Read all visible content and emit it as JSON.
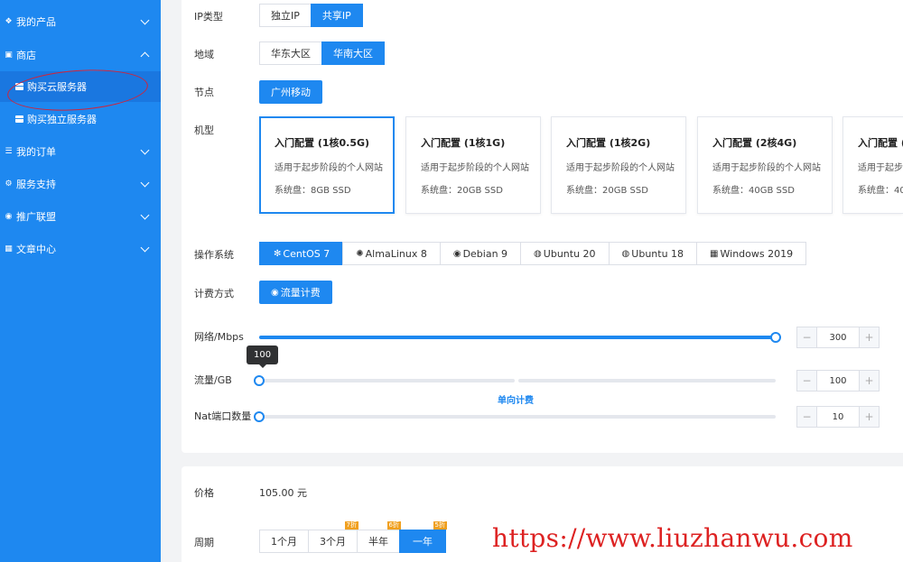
{
  "sidebar": {
    "items": [
      {
        "label": "我的产品",
        "icon": "product-icon"
      },
      {
        "label": "商店",
        "icon": "store-icon"
      },
      {
        "label": "我的订单",
        "icon": "orders-icon"
      },
      {
        "label": "服务支持",
        "icon": "support-icon"
      },
      {
        "label": "推广联盟",
        "icon": "affiliate-icon"
      },
      {
        "label": "文章中心",
        "icon": "article-icon"
      }
    ],
    "subitems": [
      {
        "label": "购买云服务器"
      },
      {
        "label": "购买独立服务器"
      }
    ],
    "accent": "#1e88f0",
    "annotation_color": "#d0243a"
  },
  "form": {
    "ip_type": {
      "label": "IP类型",
      "options": [
        "独立IP",
        "共享IP"
      ],
      "selected": "共享IP"
    },
    "region": {
      "label": "地域",
      "options": [
        "华东大区",
        "华南大区"
      ],
      "selected": "华南大区"
    },
    "node": {
      "label": "节点",
      "value": "广州移动"
    },
    "model": {
      "label": "机型",
      "cards": [
        {
          "title": "入门配置 (1核0.5G)",
          "desc": "适用于起步阶段的个人网站",
          "disk": "系统盘：8GB SSD"
        },
        {
          "title": "入门配置 (1核1G)",
          "desc": "适用于起步阶段的个人网站",
          "disk": "系统盘：20GB SSD"
        },
        {
          "title": "入门配置 (1核2G)",
          "desc": "适用于起步阶段的个人网站",
          "disk": "系统盘：20GB SSD"
        },
        {
          "title": "入门配置 (2核4G)",
          "desc": "适用于起步阶段的个人网站",
          "disk": "系统盘：40GB SSD"
        },
        {
          "title": "入门配置 (",
          "desc": "适用于起步",
          "disk": "系统盘：40"
        }
      ]
    },
    "os": {
      "label": "操作系统",
      "options": [
        {
          "name": "CentOS 7",
          "icon": "centos-icon",
          "glyph": "✻"
        },
        {
          "name": "AlmaLinux 8",
          "icon": "almalinux-icon",
          "glyph": "✺"
        },
        {
          "name": "Debian 9",
          "icon": "debian-icon",
          "glyph": "◉"
        },
        {
          "name": "Ubuntu 20",
          "icon": "ubuntu-icon",
          "glyph": "◍"
        },
        {
          "name": "Ubuntu 18",
          "icon": "ubuntu-icon",
          "glyph": "◍"
        },
        {
          "name": "Windows 2019",
          "icon": "windows-icon",
          "glyph": "▦"
        }
      ],
      "selected": "CentOS 7"
    },
    "billing": {
      "label": "计费方式",
      "value": "流量计费",
      "icon": "traffic-icon"
    },
    "network": {
      "label": "网络/Mbps",
      "value": "300",
      "fraction": 1.0
    },
    "traffic": {
      "label": "流量/GB",
      "value": "100",
      "tooltip": "100",
      "fraction": 0.0,
      "note": "单向计费"
    },
    "nat": {
      "label": "Nat端口数量",
      "value": "10",
      "fraction": 0.0
    }
  },
  "price": {
    "label": "价格",
    "value": "105.00 元"
  },
  "period": {
    "label": "周期",
    "options": [
      {
        "name": "1个月",
        "badge": ""
      },
      {
        "name": "3个月",
        "badge": "7折"
      },
      {
        "name": "半年",
        "badge": "6折"
      },
      {
        "name": "一年",
        "badge": "5折"
      }
    ],
    "selected": "一年"
  },
  "watermark": "https://www.liuzhanwu.com"
}
